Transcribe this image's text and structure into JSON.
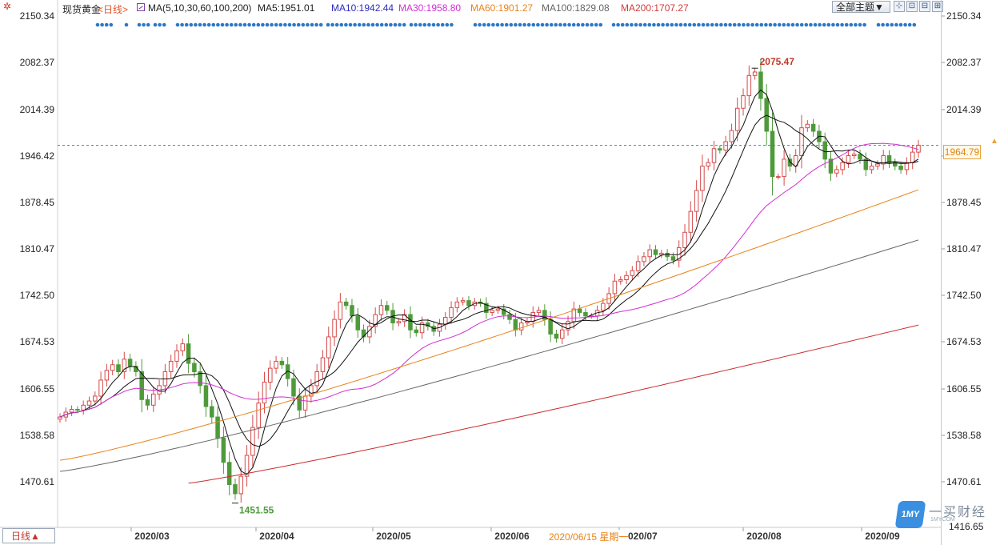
{
  "header": {
    "symbol": "现货黄金",
    "period": "<日线>",
    "ma_params": "MA(5,10,30,60,100,200)",
    "ma5": "MA5:1951.01",
    "ma10": "MA10:1942.44",
    "ma30": "MA30:1958.80",
    "ma60": "MA60:1901.27",
    "ma100": "MA100:1829.08",
    "ma200": "MA200:1707.27",
    "theme": "全部主题▼",
    "tools": [
      "⊹",
      "⊡",
      "⊟",
      "⊞"
    ]
  },
  "footer": {
    "period_button": "日线▲",
    "date_tip": "2020/06/15 星期一"
  },
  "logo": {
    "name": "一买财经",
    "badge": "1MY",
    "url": "1MYCOM"
  },
  "colors": {
    "up": "#d54a4a",
    "down": "#4e9a3a",
    "ma5": "#111111",
    "ma10": "#111111",
    "ma30": "#d12fd1",
    "ma60": "#e8831a",
    "ma100": "#666666",
    "ma200": "#cc2b2b",
    "last_price_line": "#3a7fc0",
    "event_dots": "#2a78c8"
  },
  "chart_data": {
    "type": "candlestick",
    "y_ticks": [
      "2150.34",
      "2082.37",
      "2014.39",
      "1946.42",
      "1878.45",
      "1810.47",
      "1742.50",
      "1674.53",
      "1606.55",
      "1538.58",
      "1470.61",
      "1416.65"
    ],
    "ylim": [
      1416.65,
      2150.34
    ],
    "x_labels": [
      "2020/03",
      "2020/04",
      "2020/05",
      "2020/06",
      "2020/07",
      "2020/08",
      "2020/09"
    ],
    "current_price": "1964.79",
    "high_label": "2075.47",
    "low_label": "1451.55",
    "moving_averages": [
      "MA5",
      "MA10",
      "MA30",
      "MA60",
      "MA100",
      "MA200"
    ],
    "close_series_est": [
      1575,
      1582,
      1586,
      1585,
      1592,
      1598,
      1605,
      1628,
      1642,
      1650,
      1640,
      1658,
      1648,
      1640,
      1600,
      1592,
      1608,
      1620,
      1640,
      1655,
      1670,
      1680,
      1652,
      1640,
      1620,
      1590,
      1575,
      1545,
      1510,
      1478,
      1465,
      1490,
      1520,
      1560,
      1595,
      1625,
      1645,
      1655,
      1650,
      1630,
      1605,
      1585,
      1605,
      1620,
      1640,
      1660,
      1690,
      1715,
      1740,
      1735,
      1720,
      1700,
      1690,
      1705,
      1722,
      1735,
      1728,
      1710,
      1712,
      1722,
      1700,
      1696,
      1710,
      1705,
      1698,
      1708,
      1718,
      1732,
      1740,
      1742,
      1735,
      1740,
      1738,
      1725,
      1728,
      1730,
      1722,
      1715,
      1700,
      1710,
      1712,
      1725,
      1728,
      1715,
      1694,
      1688,
      1700,
      1712,
      1730,
      1725,
      1720,
      1720,
      1728,
      1738,
      1752,
      1770,
      1772,
      1778,
      1785,
      1798,
      1805,
      1815,
      1808,
      1810,
      1805,
      1800,
      1818,
      1840,
      1870,
      1900,
      1935,
      1940,
      1960,
      1958,
      1970,
      1986,
      2018,
      2036,
      2065,
      2070,
      2032,
      1985,
      1920,
      1920,
      1945,
      1935,
      1950,
      1990,
      1995,
      1985,
      1970,
      1945,
      1925,
      1930,
      1940,
      1950,
      1952,
      1945,
      1930,
      1935,
      1938,
      1950,
      1940,
      1935,
      1930,
      1940,
      1955,
      1965
    ]
  }
}
